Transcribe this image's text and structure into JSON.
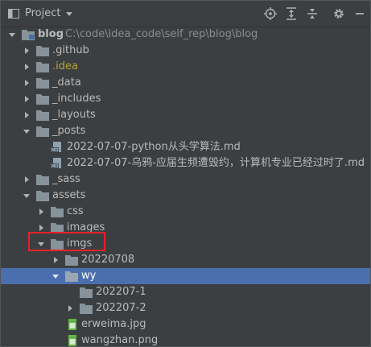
{
  "header": {
    "title": "Project"
  },
  "tree": {
    "root": {
      "name": "blog",
      "path": "C:\\code\\idea_code\\self_rep\\blog\\blog"
    },
    "items": [
      {
        "label": ".github"
      },
      {
        "label": ".idea"
      },
      {
        "label": "_data"
      },
      {
        "label": "_includes"
      },
      {
        "label": "_layouts"
      },
      {
        "label": "_posts"
      },
      {
        "label": "2022-07-07-python从头学算法.md"
      },
      {
        "label": "2022-07-07-乌鸦-应届生频遭毁约，计算机专业已经过时了.md"
      },
      {
        "label": "_sass"
      },
      {
        "label": "assets"
      },
      {
        "label": "css"
      },
      {
        "label": "images"
      },
      {
        "label": "imgs"
      },
      {
        "label": "20220708"
      },
      {
        "label": "wy"
      },
      {
        "label": "202207-1"
      },
      {
        "label": "202207-2"
      },
      {
        "label": "erweima.jpg"
      },
      {
        "label": "wangzhan.png"
      }
    ]
  },
  "colors": {
    "background": "#3c3f41",
    "selection": "#4b6eaf",
    "highlight_box": "#e8202a",
    "idea_folder_text": "#b2a53d"
  }
}
